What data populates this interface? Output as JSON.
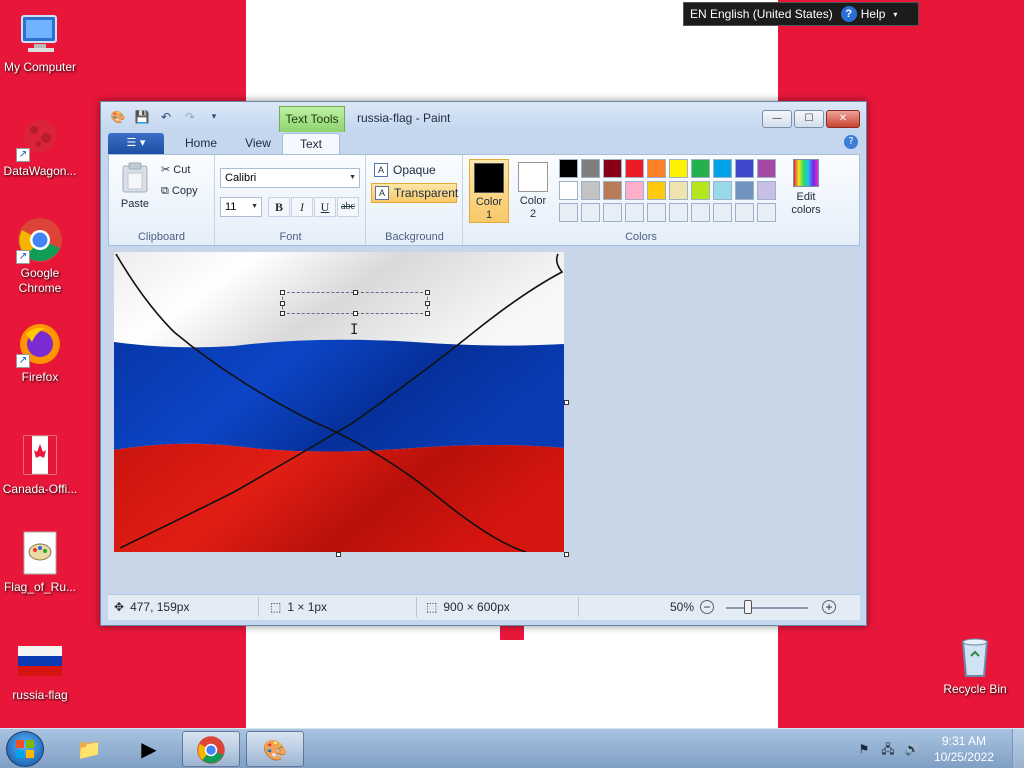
{
  "language_bar": {
    "language": "EN English (United States)",
    "help": "Help"
  },
  "desktop": {
    "icons": [
      {
        "label": "My Computer"
      },
      {
        "label": "DataWagon..."
      },
      {
        "label": "Google Chrome"
      },
      {
        "label": "Firefox"
      },
      {
        "label": "Canada-Offi..."
      },
      {
        "label": "Flag_of_Ru..."
      },
      {
        "label": "russia-flag"
      },
      {
        "label": "Recycle Bin"
      }
    ]
  },
  "window": {
    "title": "russia-flag - Paint",
    "contextual_tab": "Text Tools",
    "controls": {
      "minimize": "—",
      "maximize": "☐",
      "close": "✕"
    }
  },
  "tabs": [
    {
      "label": "Home"
    },
    {
      "label": "View"
    },
    {
      "label": "Text"
    }
  ],
  "ribbon": {
    "clipboard": {
      "label": "Clipboard",
      "paste": "Paste",
      "cut": "Cut",
      "copy": "Copy"
    },
    "font": {
      "label": "Font",
      "family": "Calibri",
      "size": "11",
      "bold": "B",
      "italic": "I",
      "underline": "U",
      "strikethrough": "abc"
    },
    "background": {
      "label": "Background",
      "opaque": "Opaque",
      "transparent": "Transparent"
    },
    "colors": {
      "label": "Colors",
      "color1_label": "Color 1",
      "color2_label": "Color 2",
      "color1": "#000000",
      "color2": "#ffffff",
      "palette": [
        "#000000",
        "#7f7f7f",
        "#880015",
        "#ed1c24",
        "#ff7f27",
        "#fff200",
        "#22b14c",
        "#00a2e8",
        "#3f48cc",
        "#a349a4",
        "#ffffff",
        "#c3c3c3",
        "#b97a57",
        "#ffaec9",
        "#ffc90e",
        "#efe4b0",
        "#b5e61d",
        "#99d9ea",
        "#7092be",
        "#c8bfe7",
        "#e8eef6",
        "#e8eef6",
        "#e8eef6",
        "#e8eef6",
        "#e8eef6",
        "#e8eef6",
        "#e8eef6",
        "#e8eef6",
        "#e8eef6",
        "#e8eef6"
      ],
      "edit_colors": "Edit colors"
    }
  },
  "image": {
    "flag_colors": [
      "#ffffff",
      "#0a3bb3",
      "#d5150f"
    ]
  },
  "statusbar": {
    "cursor_pos": "477, 159px",
    "selection_size": "1 × 1px",
    "image_size": "900 × 600px",
    "zoom": "50%",
    "zoom_level": 0.5
  },
  "taskbar": {
    "clock_time": "9:31 AM",
    "clock_date": "10/25/2022"
  }
}
